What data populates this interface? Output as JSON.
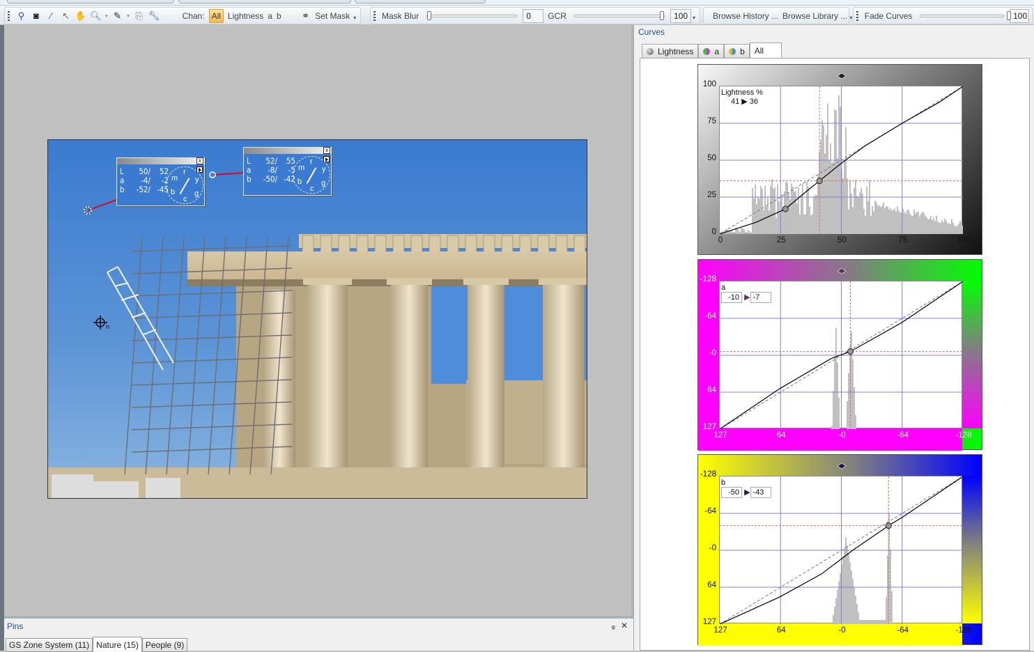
{
  "toolbar": {
    "chan_label": "Chan:",
    "channels": [
      "All",
      "Lightness",
      "a",
      "b"
    ],
    "active_channel": "All",
    "set_mask": "Set Mask",
    "mask_blur_label": "Mask Blur",
    "mask_blur_value": "0",
    "gcr_label": "GCR",
    "gcr_value": "100",
    "browse_history": "Browse History ...",
    "browse_library": "Browse Library ...",
    "fade_curves_label": "Fade Curves",
    "fade_curves_value": "100",
    "icons": [
      "point-sampler-icon",
      "mask-icon",
      "magic-wand-icon",
      "pointer-icon",
      "hand-icon",
      "zoom-icon",
      "eyedropper-icon",
      "copy-icon",
      "wrench-icon"
    ],
    "sliders": {
      "mask_blur": 0,
      "gcr": 100,
      "fade_curves": 100
    }
  },
  "samplers": [
    {
      "L": [
        "50/",
        "52"
      ],
      "a": [
        "-4/",
        "-2"
      ],
      "b": [
        "-52/",
        "-45"
      ],
      "dial": [
        "r",
        "y",
        "g",
        "c",
        "b",
        "m"
      ]
    },
    {
      "L": [
        "52/",
        "55"
      ],
      "a": [
        "-8/",
        "-5"
      ],
      "b": [
        "-50/",
        "-42"
      ],
      "dial": [
        "r",
        "y",
        "g",
        "c",
        "b",
        "m"
      ]
    }
  ],
  "sampler_marker_label": "n",
  "curves_panel": {
    "title": "Curves",
    "tabs": [
      {
        "label": "Lightness",
        "ball": "#555555"
      },
      {
        "label": "a",
        "ball": "#c040c0"
      },
      {
        "label": "b",
        "ball": "#4090d0"
      },
      {
        "label": "All",
        "ball": null
      }
    ],
    "active_tab": "All"
  },
  "chart_data": [
    {
      "type": "line",
      "title": "Lightness %",
      "readout": {
        "in": "41",
        "out": "36"
      },
      "xlim": [
        0,
        100
      ],
      "ylim": [
        0,
        100
      ],
      "xticks": [
        "0",
        "25",
        "50",
        "75",
        "100"
      ],
      "yticks": [
        "100",
        "75",
        "50",
        "25",
        "0"
      ],
      "grid": true,
      "curve": {
        "x": [
          0,
          15,
          27,
          35,
          41,
          50,
          60,
          75,
          90,
          100
        ],
        "y": [
          0,
          8,
          17,
          28,
          36,
          48,
          60,
          75,
          89,
          100
        ]
      },
      "control_points": [
        {
          "x": 27,
          "y": 17
        },
        {
          "x": 41,
          "y": 36
        }
      ],
      "guide": {
        "x": 41,
        "y": 36
      },
      "histogram_peak_range": [
        40,
        52
      ],
      "colors": {
        "left": "#f0f0f0",
        "right": "#000000"
      }
    },
    {
      "type": "line",
      "title": "a",
      "readout": {
        "in": "-10",
        "out": "-7"
      },
      "xlim": [
        127,
        -128
      ],
      "ylim": [
        127,
        -128
      ],
      "xticks": [
        "127",
        "64",
        "-0",
        "-64",
        "-128"
      ],
      "yticks": [
        "-128",
        "-64",
        "-0",
        "64",
        "127"
      ],
      "grid": true,
      "curve": {
        "x": [
          127,
          64,
          10,
          -10,
          -64,
          -128
        ],
        "y": [
          127,
          57,
          5,
          -7,
          -57,
          -128
        ]
      },
      "control_points": [
        {
          "x": -10,
          "y": -7
        }
      ],
      "guide": {
        "x": -10,
        "y": -7
      },
      "histogram_peak_range": [
        5,
        -12
      ],
      "colors": {
        "left": "#ff00ff",
        "right": "#00ff00"
      }
    },
    {
      "type": "line",
      "title": "b",
      "readout": {
        "in": "-50",
        "out": "-43"
      },
      "xlim": [
        127,
        -128
      ],
      "ylim": [
        127,
        -128
      ],
      "xticks": [
        "127",
        "64",
        "-0",
        "-64",
        "-128"
      ],
      "yticks": [
        "-128",
        "-64",
        "-0",
        "64",
        "127"
      ],
      "grid": true,
      "curve": {
        "x": [
          127,
          64,
          20,
          0,
          -12,
          -50,
          -64,
          -128
        ],
        "y": [
          127,
          80,
          40,
          15,
          0,
          -43,
          -57,
          -128
        ]
      },
      "control_points": [
        {
          "x": -50,
          "y": -43
        }
      ],
      "guide": {
        "x": -50,
        "y": -43
      },
      "histogram_peak_range": [
        0,
        -50
      ],
      "colors": {
        "left": "#ffff00",
        "right": "#0000ff"
      }
    }
  ],
  "pins": {
    "title": "Pins",
    "pin_icon": "pin-icon",
    "close_icon": "close-icon",
    "tabs": [
      "GS Zone System (11)",
      "Nature (15)",
      "People (9)"
    ],
    "active_tab": "Nature (15)"
  }
}
